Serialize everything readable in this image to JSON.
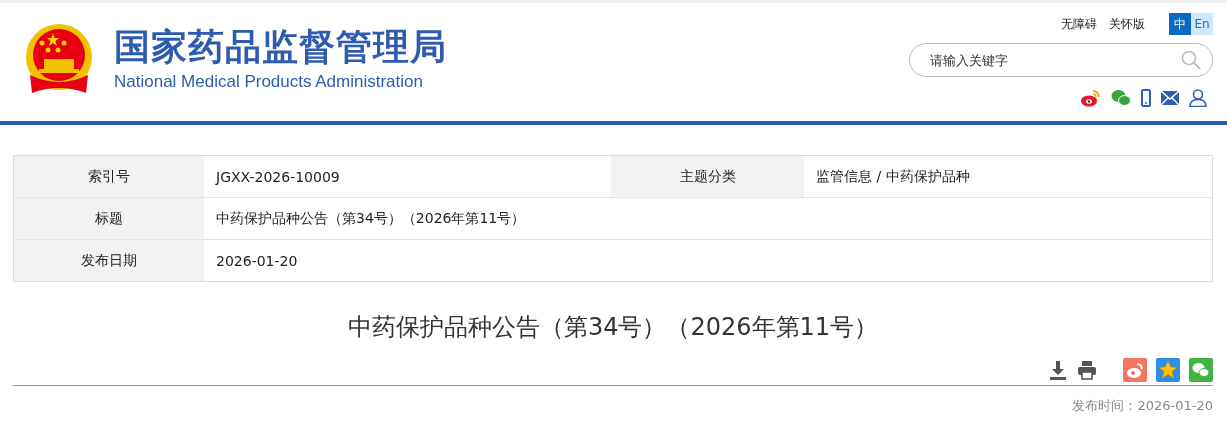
{
  "header": {
    "title_cn": "国家药品监督管理局",
    "title_en": "National Medical Products Administration",
    "links": [
      "无障碍",
      "关怀版"
    ],
    "languages": [
      {
        "label": "中",
        "selected": true
      },
      {
        "label": "En",
        "selected": false
      }
    ],
    "search": {
      "placeholder": "请输入关键字"
    }
  },
  "info_table": {
    "rows": [
      {
        "cells": [
          {
            "kind": "label",
            "text": "索引号"
          },
          {
            "kind": "value",
            "text": "JGXX-2026-10009"
          },
          {
            "kind": "label",
            "text": "主题分类"
          },
          {
            "kind": "value",
            "text": "监管信息 / 中药保护品种"
          }
        ]
      },
      {
        "cells": [
          {
            "kind": "label",
            "text": "标题"
          },
          {
            "kind": "wide",
            "text": "中药保护品种公告（第34号）（2026年第11号）"
          }
        ]
      },
      {
        "cells": [
          {
            "kind": "label",
            "text": "发布日期"
          },
          {
            "kind": "wide",
            "text": "2026-01-20"
          }
        ]
      }
    ]
  },
  "article": {
    "title": "中药保护品种公告（第34号）（2026年第11号）",
    "publish_time": "发布时间：2026-01-20"
  }
}
